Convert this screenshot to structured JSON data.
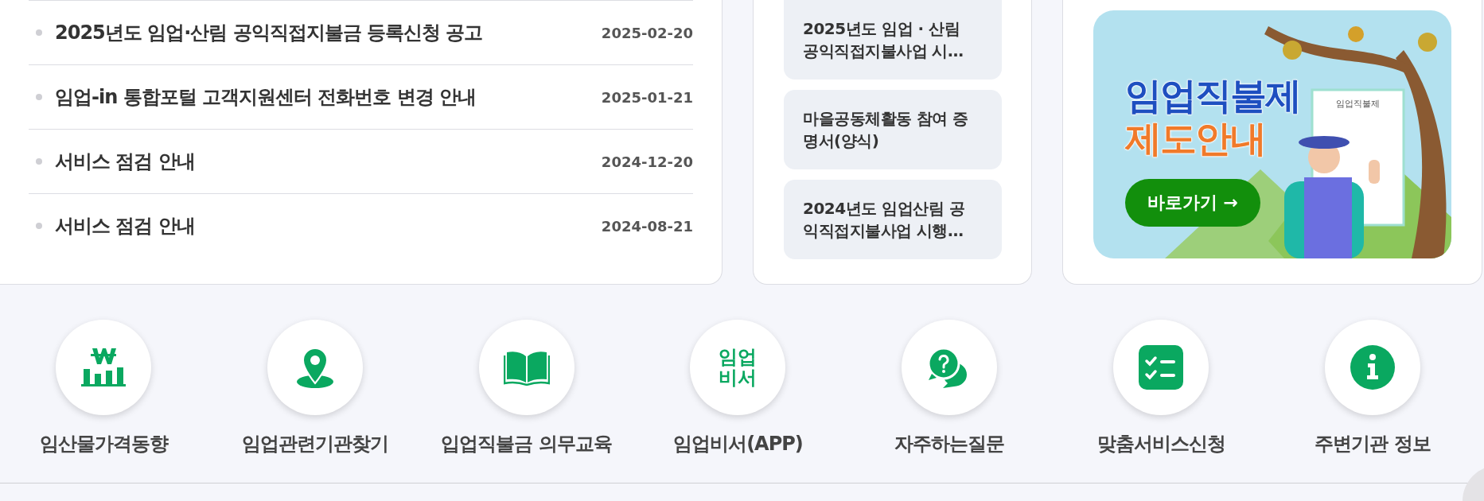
{
  "notices": [
    {
      "title": "2025년도 임업·산림 공익직접지불금 등록신청 공고",
      "date": "2025-02-20"
    },
    {
      "title": "임업-in 통합포털 고객지원센터 전화번호 변경 안내",
      "date": "2025-01-21"
    },
    {
      "title": "서비스 점검 안내",
      "date": "2024-12-20"
    },
    {
      "title": "서비스 점검 안내",
      "date": "2024-08-21"
    }
  ],
  "documents": [
    {
      "title": "2025년도 임업 · 산림\n공익직접지불사업 시…"
    },
    {
      "title": "마을공동체활동 참여 증\n명서(양식)"
    },
    {
      "title": "2024년도 임업산림 공\n익직접지불사업 시행…"
    }
  ],
  "banner": {
    "title_lines": [
      "임업직불제",
      "제도안내"
    ],
    "button": "바로가기 →",
    "clipboard_title": "임업직불제"
  },
  "quick_links": [
    {
      "kind": "price",
      "label": "임산물가격동향"
    },
    {
      "kind": "location",
      "label": "임업관련기관찾기"
    },
    {
      "kind": "book",
      "label": "입업직불금 의무교육"
    },
    {
      "kind": "text",
      "label": "임업비서(APP)",
      "icon_text": [
        "임업",
        "비서"
      ]
    },
    {
      "kind": "faq",
      "label": "자주하는질문"
    },
    {
      "kind": "checklist",
      "label": "맞춤서비스신청"
    },
    {
      "kind": "info",
      "label": "주변기관 정보"
    }
  ]
}
